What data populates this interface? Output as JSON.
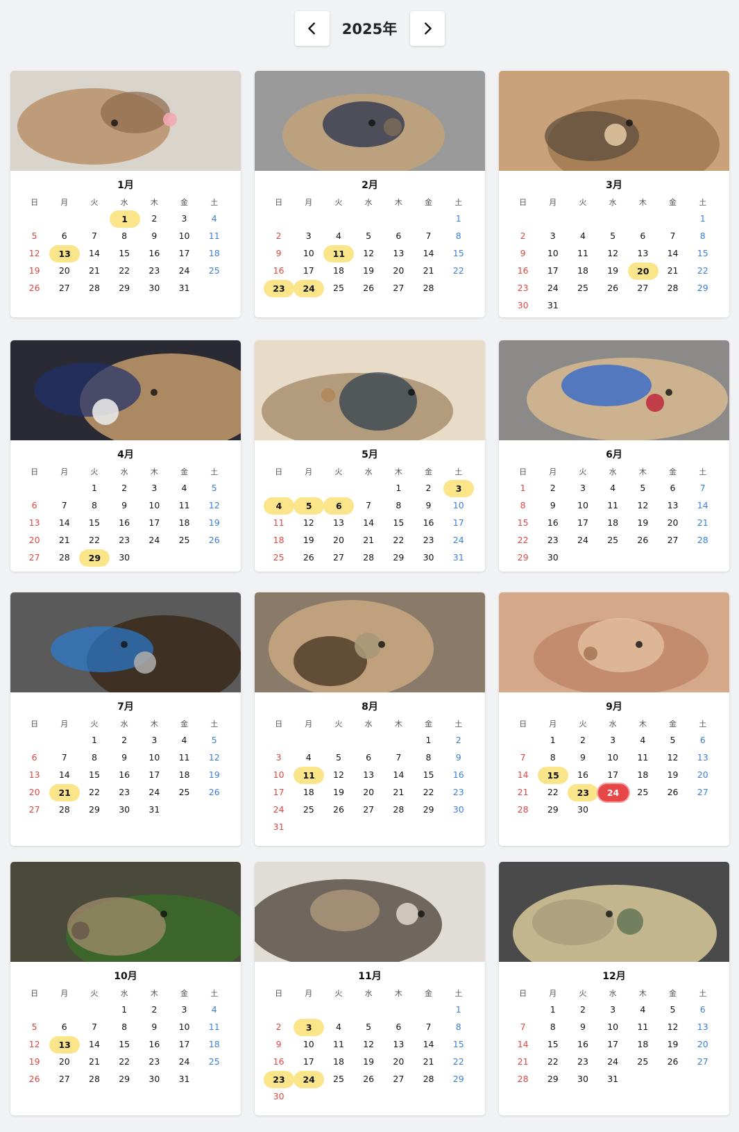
{
  "header": {
    "year": "2025年",
    "prev_icon": "chevron-left-icon",
    "next_icon": "chevron-right-icon"
  },
  "weekdays": [
    "日",
    "月",
    "火",
    "水",
    "木",
    "金",
    "土"
  ],
  "colors": {
    "sunday": "#e0463f",
    "saturday": "#3b7fd8",
    "highlight": "#fbe58a",
    "today": "#e84747"
  },
  "months": [
    {
      "title": "1月",
      "start": 3,
      "days": 31,
      "highlights": [
        1,
        13
      ],
      "today": null,
      "photo": "dog-sleeping-blanket-pink-toy"
    },
    {
      "title": "2月",
      "start": 6,
      "days": 28,
      "highlights": [
        11,
        23,
        24
      ],
      "today": null,
      "photo": "dog-navy-shirt-lap"
    },
    {
      "title": "3月",
      "start": 6,
      "days": 31,
      "highlights": [
        20
      ],
      "today": null,
      "photo": "dog-paw-closeup"
    },
    {
      "title": "4月",
      "start": 2,
      "days": 30,
      "highlights": [
        29
      ],
      "today": null,
      "photo": "dog-held-in-arms"
    },
    {
      "title": "5月",
      "start": 4,
      "days": 31,
      "highlights": [
        3,
        4,
        5,
        6
      ],
      "today": null,
      "photo": "dog-under-shelf"
    },
    {
      "title": "6月",
      "start": 0,
      "days": 30,
      "highlights": [],
      "today": null,
      "photo": "dog-blue-harness-walk"
    },
    {
      "title": "7月",
      "start": 2,
      "days": 31,
      "highlights": [
        21
      ],
      "today": null,
      "photo": "dog-in-car"
    },
    {
      "title": "8月",
      "start": 5,
      "days": 31,
      "highlights": [
        11
      ],
      "today": null,
      "photo": "dog-lying-carpet"
    },
    {
      "title": "9月",
      "start": 1,
      "days": 30,
      "highlights": [
        15,
        23
      ],
      "today": 24,
      "photo": "dog-fur-closeup"
    },
    {
      "title": "10月",
      "start": 3,
      "days": 31,
      "highlights": [
        13
      ],
      "today": null,
      "photo": "dog-outdoor-ferns"
    },
    {
      "title": "11月",
      "start": 6,
      "days": 30,
      "highlights": [
        3,
        23,
        24
      ],
      "today": null,
      "photo": "dog-on-step-bed"
    },
    {
      "title": "12月",
      "start": 1,
      "days": 31,
      "highlights": [],
      "today": null,
      "photo": "dog-sleeping-rug"
    }
  ]
}
